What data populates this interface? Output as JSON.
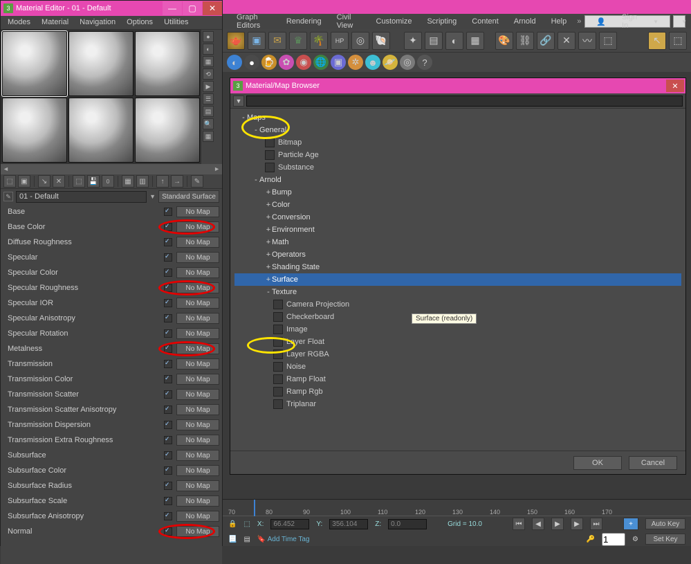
{
  "material_editor": {
    "title": "Material Editor - 01 - Default",
    "menu": [
      "Modes",
      "Material",
      "Navigation",
      "Options",
      "Utilities"
    ],
    "material_name": "01 - Default",
    "material_type": "Standard Surface",
    "slots": [
      {
        "label": "Base",
        "checked": true,
        "map": "No Map",
        "circled": false
      },
      {
        "label": "Base Color",
        "checked": true,
        "map": "No Map",
        "circled": true
      },
      {
        "label": "Diffuse Roughness",
        "checked": true,
        "map": "No Map",
        "circled": false
      },
      {
        "label": "Specular",
        "checked": true,
        "map": "No Map",
        "circled": false
      },
      {
        "label": "Specular Color",
        "checked": true,
        "map": "No Map",
        "circled": false
      },
      {
        "label": "Specular Roughness",
        "checked": true,
        "map": "No Map",
        "circled": true
      },
      {
        "label": "Specular IOR",
        "checked": true,
        "map": "No Map",
        "circled": false
      },
      {
        "label": "Specular Anisotropy",
        "checked": true,
        "map": "No Map",
        "circled": false
      },
      {
        "label": "Specular Rotation",
        "checked": true,
        "map": "No Map",
        "circled": false
      },
      {
        "label": "Metalness",
        "checked": true,
        "map": "No Map",
        "circled": true
      },
      {
        "label": "Transmission",
        "checked": true,
        "map": "No Map",
        "circled": false
      },
      {
        "label": "Transmission Color",
        "checked": true,
        "map": "No Map",
        "circled": false
      },
      {
        "label": "Transmission Scatter",
        "checked": true,
        "map": "No Map",
        "circled": false
      },
      {
        "label": "Transmission Scatter Anisotropy",
        "checked": true,
        "map": "No Map",
        "circled": false
      },
      {
        "label": "Transmission Dispersion",
        "checked": true,
        "map": "No Map",
        "circled": false
      },
      {
        "label": "Transmission Extra Roughness",
        "checked": true,
        "map": "No Map",
        "circled": false
      },
      {
        "label": "Subsurface",
        "checked": true,
        "map": "No Map",
        "circled": false
      },
      {
        "label": "Subsurface Color",
        "checked": true,
        "map": "No Map",
        "circled": false
      },
      {
        "label": "Subsurface Radius",
        "checked": true,
        "map": "No Map",
        "circled": false
      },
      {
        "label": "Subsurface Scale",
        "checked": true,
        "map": "No Map",
        "circled": false
      },
      {
        "label": "Subsurface Anisotropy",
        "checked": true,
        "map": "No Map",
        "circled": false
      },
      {
        "label": "Normal",
        "checked": true,
        "map": "No Map",
        "circled": true
      }
    ]
  },
  "main_menu": [
    "Graph Editors",
    "Rendering",
    "Civil View",
    "Customize",
    "Scripting",
    "Content",
    "Arnold",
    "Help"
  ],
  "signin_label": "Sign In",
  "browser": {
    "title": "Material/Map Browser",
    "tooltip": "Surface (readonly)",
    "ok": "OK",
    "cancel": "Cancel",
    "tree": [
      {
        "lvl": 0,
        "exp": "-",
        "label": "Maps",
        "type": "cat"
      },
      {
        "lvl": 1,
        "exp": "-",
        "label": "General",
        "type": "cat",
        "oval": true
      },
      {
        "lvl": 2,
        "exp": "",
        "label": "Bitmap",
        "type": "item",
        "oval_item": true
      },
      {
        "lvl": 2,
        "exp": "",
        "label": "Particle Age",
        "type": "item"
      },
      {
        "lvl": 2,
        "exp": "",
        "label": "Substance",
        "type": "item"
      },
      {
        "lvl": 1,
        "exp": "-",
        "label": "Arnold",
        "type": "cat"
      },
      {
        "lvl": 2,
        "exp": "+",
        "label": "Bump",
        "type": "sub"
      },
      {
        "lvl": 2,
        "exp": "+",
        "label": "Color",
        "type": "sub"
      },
      {
        "lvl": 2,
        "exp": "+",
        "label": "Conversion",
        "type": "sub"
      },
      {
        "lvl": 2,
        "exp": "+",
        "label": "Environment",
        "type": "sub"
      },
      {
        "lvl": 2,
        "exp": "+",
        "label": "Math",
        "type": "sub"
      },
      {
        "lvl": 2,
        "exp": "+",
        "label": "Operators",
        "type": "sub"
      },
      {
        "lvl": 2,
        "exp": "+",
        "label": "Shading State",
        "type": "sub"
      },
      {
        "lvl": 2,
        "exp": "+",
        "label": "Surface",
        "type": "sub",
        "selected": true
      },
      {
        "lvl": 2,
        "exp": "-",
        "label": "Texture",
        "type": "sub"
      },
      {
        "lvl": 3,
        "exp": "",
        "label": "Camera Projection",
        "type": "item"
      },
      {
        "lvl": 3,
        "exp": "",
        "label": "Checkerboard",
        "type": "item"
      },
      {
        "lvl": 3,
        "exp": "",
        "label": "Image",
        "type": "item",
        "oval_item": true
      },
      {
        "lvl": 3,
        "exp": "",
        "label": "Layer Float",
        "type": "item"
      },
      {
        "lvl": 3,
        "exp": "",
        "label": "Layer RGBA",
        "type": "item"
      },
      {
        "lvl": 3,
        "exp": "",
        "label": "Noise",
        "type": "item"
      },
      {
        "lvl": 3,
        "exp": "",
        "label": "Ramp Float",
        "type": "item"
      },
      {
        "lvl": 3,
        "exp": "",
        "label": "Ramp Rgb",
        "type": "item"
      },
      {
        "lvl": 3,
        "exp": "",
        "label": "Triplanar",
        "type": "item"
      }
    ]
  },
  "timeline": {
    "frames": [
      "70",
      "80",
      "90",
      "100",
      "110",
      "120",
      "130",
      "140",
      "150",
      "160",
      "170"
    ],
    "coords": {
      "x_label": "X:",
      "x": "66.452",
      "y_label": "Y:",
      "y": "356.104",
      "z_label": "Z:",
      "z": "0.0",
      "grid_label": "Grid = 10.0"
    },
    "add_time_tag": "Add Time Tag",
    "frame_field": "1",
    "auto_key": "Auto Key",
    "set_key": "Set Key"
  }
}
